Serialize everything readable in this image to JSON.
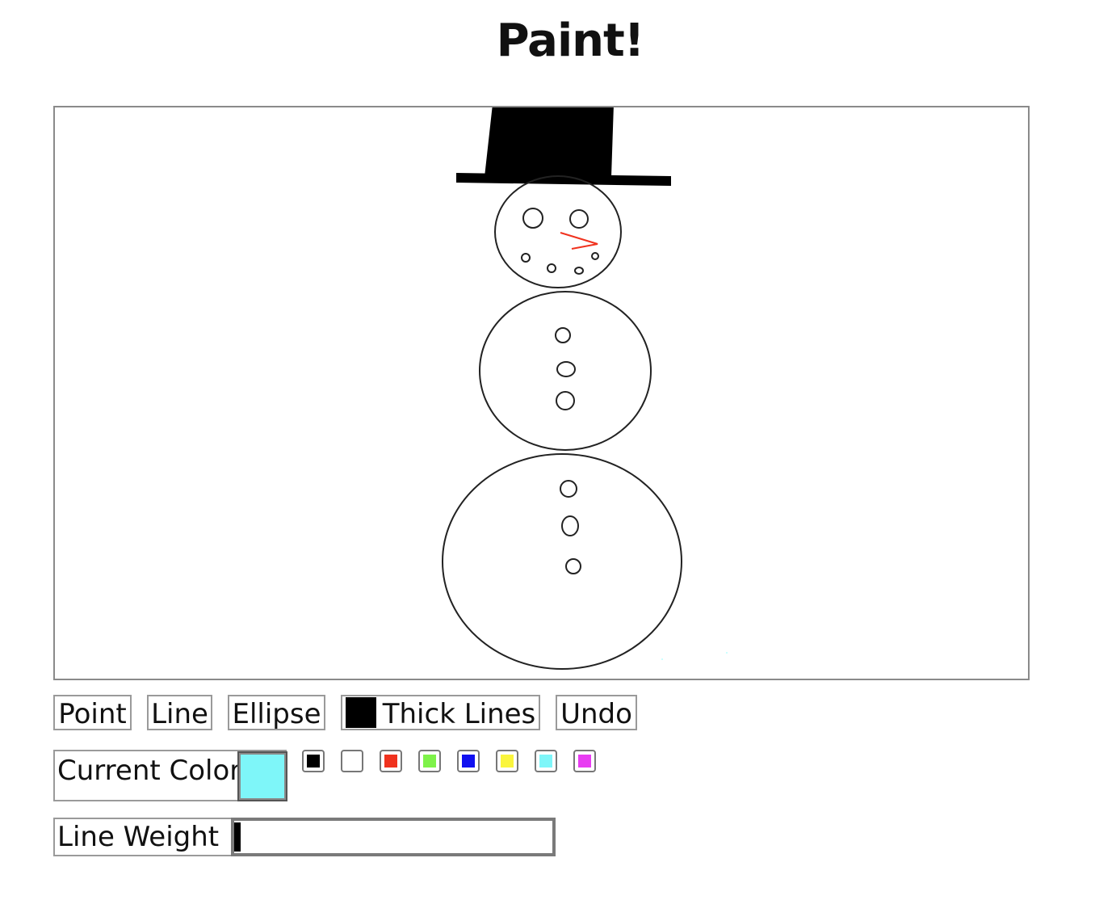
{
  "page": {
    "title": "Paint!"
  },
  "toolbar": {
    "point_label": "Point",
    "line_label": "Line",
    "ellipse_label": "Ellipse",
    "thick_lines_label": "Thick Lines",
    "undo_label": "Undo"
  },
  "color_panel": {
    "current_color_label": "Current Color",
    "current_color": "#7ef6f9",
    "palette": [
      {
        "name": "black",
        "hex": "#000000"
      },
      {
        "name": "white",
        "hex": "#ffffff"
      },
      {
        "name": "red",
        "hex": "#f0321e"
      },
      {
        "name": "green",
        "hex": "#7ef249"
      },
      {
        "name": "blue",
        "hex": "#1010f0"
      },
      {
        "name": "yellow",
        "hex": "#faf53c"
      },
      {
        "name": "cyan",
        "hex": "#7ef6f9"
      },
      {
        "name": "magenta",
        "hex": "#e83cf2"
      }
    ]
  },
  "line_weight": {
    "label": "Line Weight",
    "value_fraction": 0.02
  },
  "drawing": {
    "stroke_color": "#000000",
    "nose_color": "#f0321e"
  }
}
